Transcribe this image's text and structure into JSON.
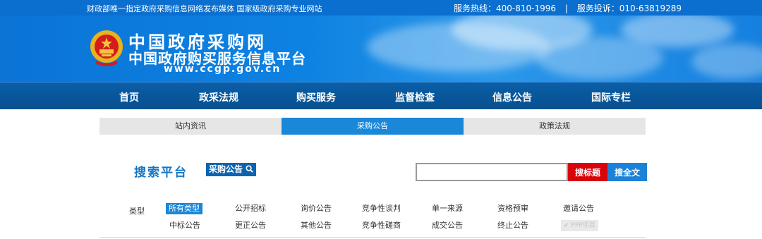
{
  "topbar": {
    "left_text": "财政部唯一指定政府采购信息网络发布媒体  国家级政府采购专业网站",
    "hotline": "服务热线：400-810-1996",
    "divider": "|",
    "complaint": "服务投诉：010-63819289"
  },
  "banner": {
    "site_name": "中国政府采购网",
    "platform_name": "中国政府购买服务信息平台",
    "url": "www.ccgp.gov.cn"
  },
  "main_nav": [
    "首页",
    "政采法规",
    "购买服务",
    "监督检查",
    "信息公告",
    "国际专栏"
  ],
  "sub_tabs": [
    {
      "label": "站内资讯",
      "active": false
    },
    {
      "label": "采购公告",
      "active": true
    },
    {
      "label": "政策法规",
      "active": false
    }
  ],
  "search": {
    "title": "搜索平台",
    "tag": "采购公告",
    "placeholder": "",
    "btn_title": "搜标题",
    "btn_full": "搜全文"
  },
  "filter": {
    "label": "类型",
    "row1": [
      "所有类型",
      "公开招标",
      "询价公告",
      "竞争性谈判",
      "单一来源",
      "资格预审",
      "邀请公告"
    ],
    "row2": [
      "中标公告",
      "更正公告",
      "其他公告",
      "竞争性磋商",
      "成交公告",
      "终止公告",
      "PPP项目"
    ],
    "active": "所有类型",
    "disabled": "PPP项目"
  },
  "colors": {
    "brand_blue": "#0a6fcf",
    "nav_blue": "#07508f",
    "accent_red": "#d9030b"
  }
}
